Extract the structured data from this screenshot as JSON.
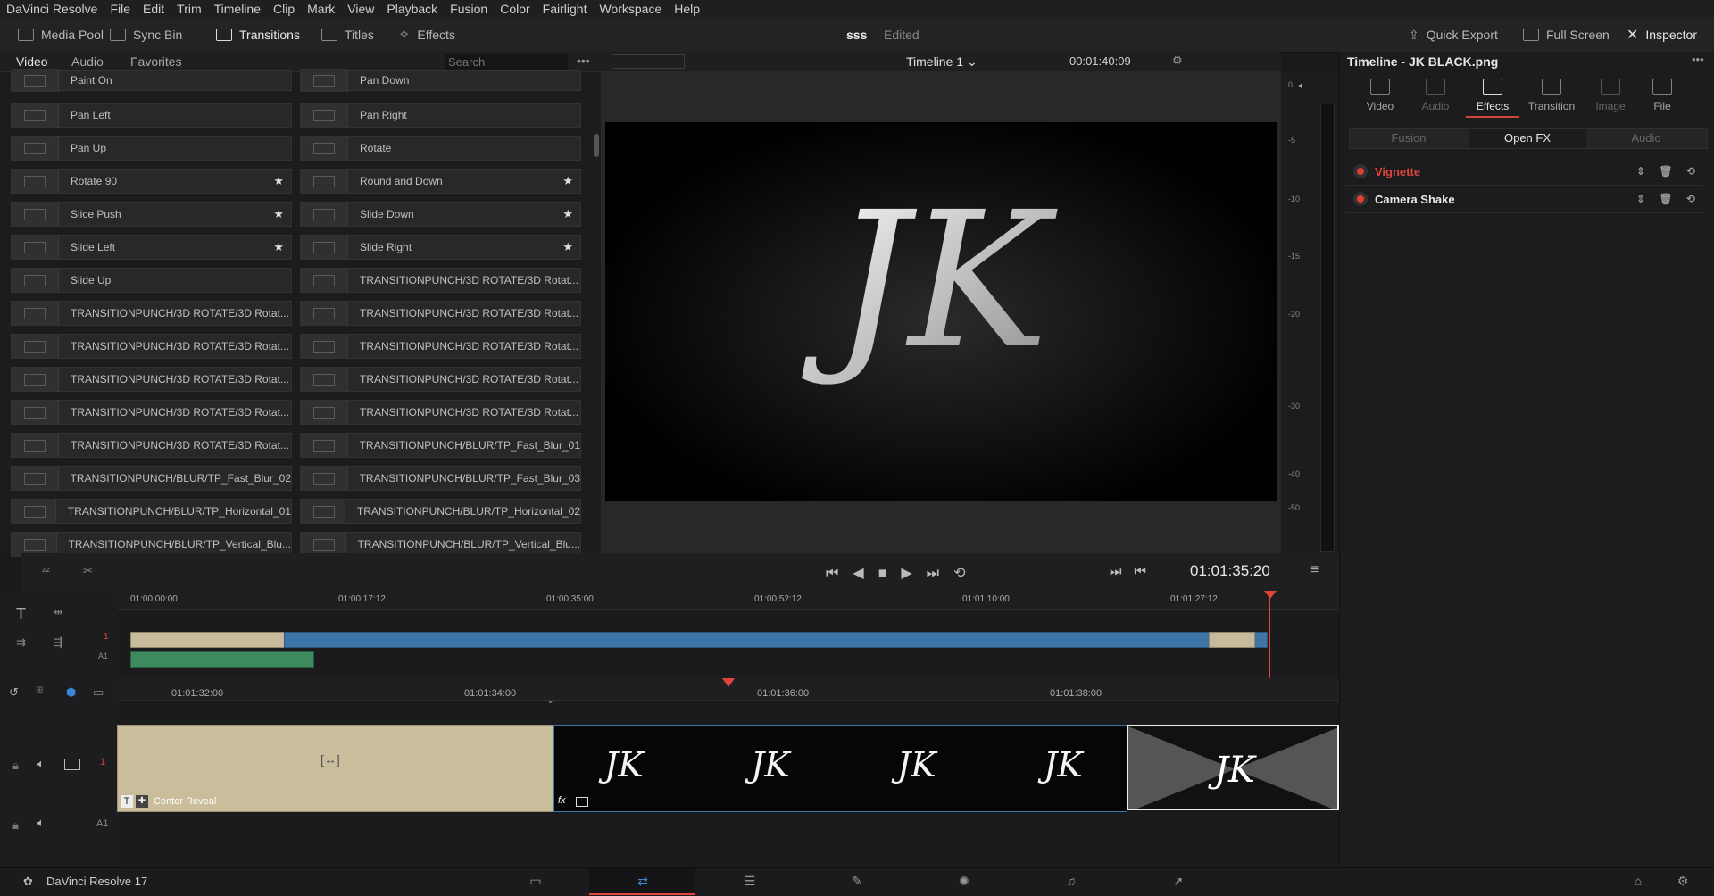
{
  "app": {
    "name": "DaVinci Resolve 17"
  },
  "menubar": [
    "DaVinci Resolve",
    "File",
    "Edit",
    "Trim",
    "Timeline",
    "Clip",
    "Mark",
    "View",
    "Playback",
    "Fusion",
    "Color",
    "Fairlight",
    "Workspace",
    "Help"
  ],
  "toolbar": {
    "media_pool": "Media Pool",
    "sync_bin": "Sync Bin",
    "transitions": "Transitions",
    "titles": "Titles",
    "effects": "Effects",
    "project": "sss",
    "project_status": "Edited",
    "quick_export": "Quick Export",
    "full_screen": "Full Screen",
    "inspector": "Inspector"
  },
  "library": {
    "tabs": [
      "Video",
      "Audio",
      "Favorites"
    ],
    "search_placeholder": "Search",
    "items": [
      {
        "label": "Paint On",
        "fav": false
      },
      {
        "label": "Pan Down",
        "fav": false
      },
      {
        "label": "Pan Left",
        "fav": false
      },
      {
        "label": "Pan Right",
        "fav": false
      },
      {
        "label": "Pan Up",
        "fav": false
      },
      {
        "label": "Rotate",
        "fav": false
      },
      {
        "label": "Rotate 90",
        "fav": true
      },
      {
        "label": "Round and Down",
        "fav": true
      },
      {
        "label": "Slice Push",
        "fav": true
      },
      {
        "label": "Slide Down",
        "fav": true
      },
      {
        "label": "Slide Left",
        "fav": true
      },
      {
        "label": "Slide Right",
        "fav": true
      },
      {
        "label": "Slide Up",
        "fav": false
      },
      {
        "label": "TRANSITIONPUNCH/3D ROTATE/3D Rotat...",
        "fav": false
      },
      {
        "label": "TRANSITIONPUNCH/3D ROTATE/3D Rotat...",
        "fav": false
      },
      {
        "label": "TRANSITIONPUNCH/3D ROTATE/3D Rotat...",
        "fav": false
      },
      {
        "label": "TRANSITIONPUNCH/3D ROTATE/3D Rotat...",
        "fav": false
      },
      {
        "label": "TRANSITIONPUNCH/3D ROTATE/3D Rotat...",
        "fav": false
      },
      {
        "label": "TRANSITIONPUNCH/3D ROTATE/3D Rotat...",
        "fav": false
      },
      {
        "label": "TRANSITIONPUNCH/3D ROTATE/3D Rotat...",
        "fav": false
      },
      {
        "label": "TRANSITIONPUNCH/3D ROTATE/3D Rotat...",
        "fav": false
      },
      {
        "label": "TRANSITIONPUNCH/3D ROTATE/3D Rotat...",
        "fav": false
      },
      {
        "label": "TRANSITIONPUNCH/3D ROTATE/3D Rotat...",
        "fav": false
      },
      {
        "label": "TRANSITIONPUNCH/BLUR/TP_Fast_Blur_01",
        "fav": false
      },
      {
        "label": "TRANSITIONPUNCH/BLUR/TP_Fast_Blur_02",
        "fav": false
      },
      {
        "label": "TRANSITIONPUNCH/BLUR/TP_Fast_Blur_03",
        "fav": false
      },
      {
        "label": "TRANSITIONPUNCH/BLUR/TP_Horizontal_01",
        "fav": false
      },
      {
        "label": "TRANSITIONPUNCH/BLUR/TP_Horizontal_02",
        "fav": false
      },
      {
        "label": "TRANSITIONPUNCH/BLUR/TP_Vertical_Blu...",
        "fav": false
      },
      {
        "label": "TRANSITIONPUNCH/BLUR/TP_Vertical_Blu...",
        "fav": false
      }
    ]
  },
  "viewer": {
    "timeline_name": "Timeline 1",
    "duration": "00:01:40:09",
    "timecode": "01:01:35:20",
    "logo_text": "JK",
    "meter_ticks": [
      "0",
      "-5",
      "-10",
      "-15",
      "-20",
      "-30",
      "-40",
      "-50"
    ]
  },
  "inspector": {
    "title": "Timeline - JK BLACK.png",
    "tabs": [
      "Video",
      "Audio",
      "Effects",
      "Transition",
      "Image",
      "File"
    ],
    "active_tab": "Effects",
    "subtabs": [
      "Fusion",
      "Open FX",
      "Audio"
    ],
    "effects": [
      {
        "name": "Vignette",
        "color": "#e0453a"
      },
      {
        "name": "Camera Shake",
        "color": "#e8e8e8"
      }
    ]
  },
  "timeline": {
    "mini_ruler": [
      "01:00:00:00",
      "01:00:17:12",
      "01:00:35:00",
      "01:00:52:12",
      "01:01:10:00",
      "01:01:27:12"
    ],
    "main_ruler": [
      "01:01:32:00",
      "01:01:34:00",
      "01:01:36:00",
      "01:01:38:00"
    ],
    "track_v1": "1",
    "track_a1": "A1",
    "title_clip": "Center Reveal",
    "fx_badge": "fx"
  },
  "statusbar": {
    "app": "DaVinci Resolve 17"
  },
  "colors": {
    "accent": "#e0453a",
    "clip_blue": "#3f76a8",
    "clip_beige": "#c7bb9b",
    "clip_green": "#3d8a5e"
  }
}
